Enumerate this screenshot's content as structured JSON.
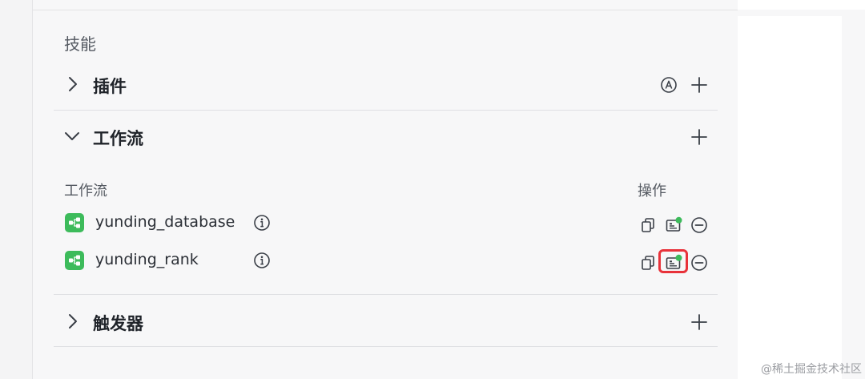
{
  "skills": {
    "title": "技能",
    "plugins": {
      "label": "插件",
      "expanded": false
    },
    "workflow": {
      "label": "工作流",
      "expanded": true,
      "table": {
        "col_name": "工作流",
        "col_actions": "操作",
        "rows": [
          {
            "name": "yunding_database"
          },
          {
            "name": "yunding_rank"
          }
        ]
      }
    },
    "triggers": {
      "label": "触发器",
      "expanded": false
    }
  },
  "watermark": "@稀土掘金技术社区",
  "colors": {
    "workflow_icon": "#3dbb5b",
    "status_dot": "#3dbb5b",
    "highlight_box": "#e8323a"
  }
}
